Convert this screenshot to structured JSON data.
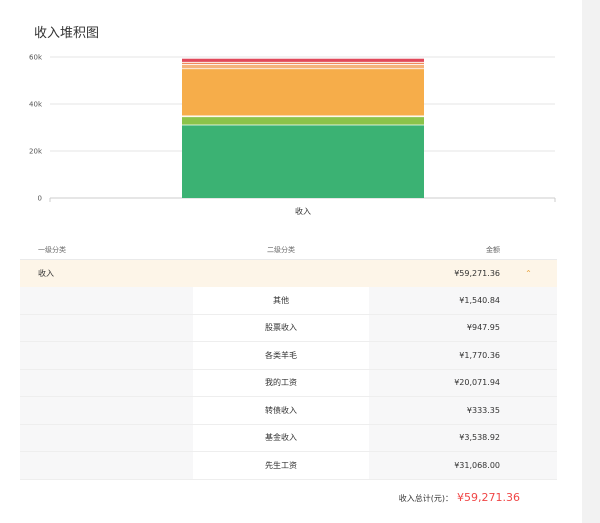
{
  "title": "收入堆积图",
  "chart_data": {
    "type": "bar",
    "stacked": true,
    "categories": [
      "收入"
    ],
    "yticks": [
      "0",
      "20k",
      "40k",
      "60k"
    ],
    "ylim": [
      0,
      60000
    ],
    "grid": true,
    "series": [
      {
        "name": "先生工资",
        "values": [
          31068.0
        ],
        "color": "#3bb273"
      },
      {
        "name": "基金收入",
        "values": [
          3538.92
        ],
        "color": "#8bc34a"
      },
      {
        "name": "转债收入",
        "values": [
          333.35
        ],
        "color": "#f7c96a"
      },
      {
        "name": "我的工资",
        "values": [
          20071.94
        ],
        "color": "#f6ad4a"
      },
      {
        "name": "各类羊毛",
        "values": [
          1770.36
        ],
        "color": "#f4b27a"
      },
      {
        "name": "股票收入",
        "values": [
          947.95
        ],
        "color": "#f08a5d"
      },
      {
        "name": "其他",
        "values": [
          1540.84
        ],
        "color": "#e0485a"
      }
    ]
  },
  "table": {
    "headers": {
      "level1": "一级分类",
      "level2": "二级分类",
      "amount": "金额"
    },
    "summary": {
      "category": "收入",
      "amount": "¥59,271.36",
      "toggle": "⌃"
    },
    "rows": [
      {
        "name": "其他",
        "amount": "¥1,540.84"
      },
      {
        "name": "股票收入",
        "amount": "¥947.95"
      },
      {
        "name": "各类羊毛",
        "amount": "¥1,770.36"
      },
      {
        "name": "我的工资",
        "amount": "¥20,071.94"
      },
      {
        "name": "转债收入",
        "amount": "¥333.35"
      },
      {
        "name": "基金收入",
        "amount": "¥3,538.92"
      },
      {
        "name": "先生工资",
        "amount": "¥31,068.00"
      }
    ]
  },
  "total": {
    "label": "收入总计(元)：",
    "value": "¥59,271.36"
  }
}
